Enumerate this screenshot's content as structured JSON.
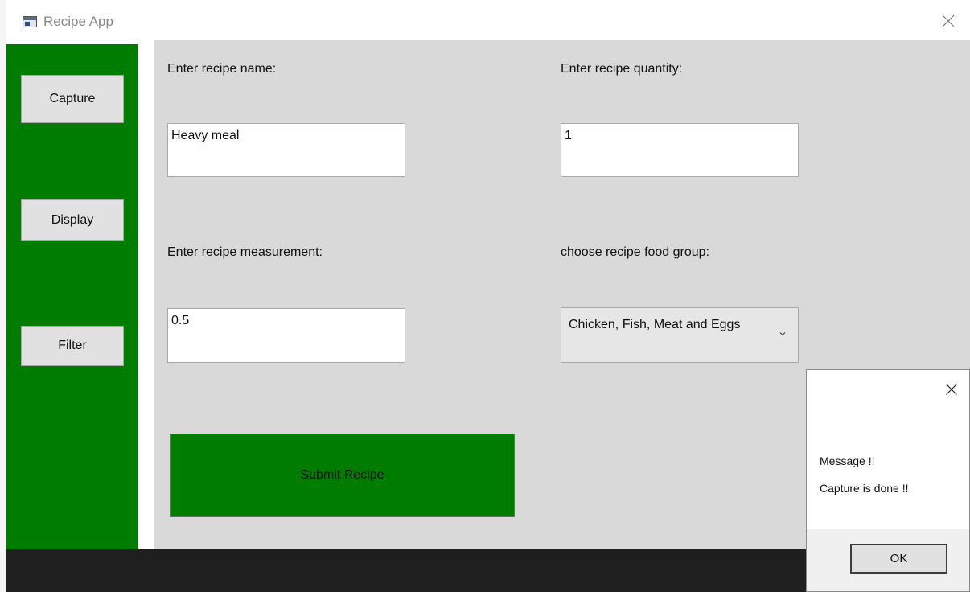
{
  "window": {
    "title": "Recipe App"
  },
  "sidebar": {
    "items": [
      {
        "label": "Capture"
      },
      {
        "label": "Display"
      },
      {
        "label": "Filter"
      }
    ]
  },
  "form": {
    "name_label": "Enter recipe name:",
    "name_value": "Heavy meal",
    "quantity_label": "Enter recipe quantity:",
    "quantity_value": "1",
    "measurement_label": "Enter recipe measurement:",
    "measurement_value": "0.5",
    "food_group_label": "choose recipe food group:",
    "food_group_value": "Chicken, Fish, Meat and Eggs",
    "submit_label": "Submit Recipe"
  },
  "dialog": {
    "title_text": "Message !!",
    "message": "Capture is done !!",
    "ok_label": "OK"
  },
  "colors": {
    "accent": "#007c00",
    "panel": "#d9d9d9",
    "taskbar": "#1f1f1f"
  }
}
